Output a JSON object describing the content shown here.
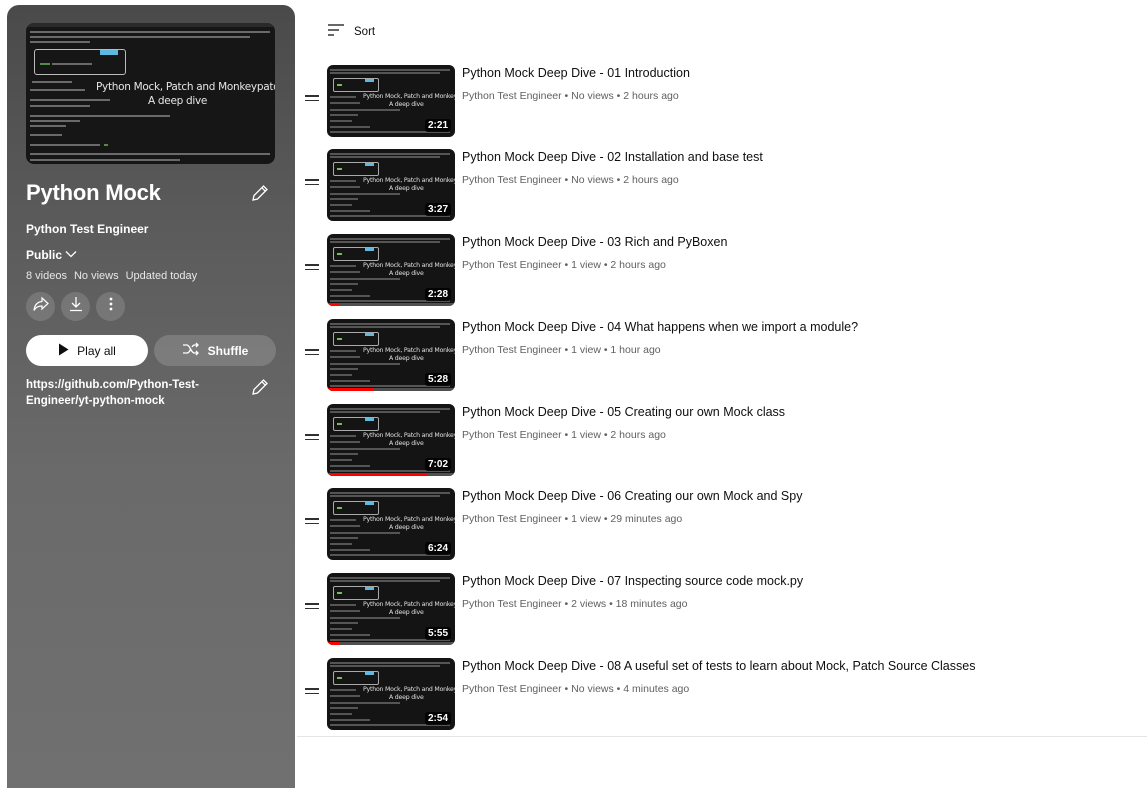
{
  "playlist": {
    "title": "Python Mock",
    "channel": "Python Test Engineer",
    "privacy": "Public",
    "video_count": "8 videos",
    "views": "No views",
    "updated": "Updated today",
    "play_all_label": "Play all",
    "shuffle_label": "Shuffle",
    "description": "https://github.com/Python-Test-Engineer/yt-python-mock",
    "hero_text_1": "Python Mock, Patch and Monkeypatch",
    "hero_text_2": "A deep dive"
  },
  "sort_label": "Sort",
  "thumb_text_1": "Python Mock, Patch and Monkeypatch",
  "thumb_text_2": "A deep dive",
  "videos": [
    {
      "title": "Python Mock Deep Dive - 01 Introduction",
      "channel": "Python Test Engineer",
      "views": "No views",
      "age": "2 hours ago",
      "duration": "2:21",
      "watched": 0
    },
    {
      "title": "Python Mock Deep Dive - 02 Installation and base test",
      "channel": "Python Test Engineer",
      "views": "No views",
      "age": "2 hours ago",
      "duration": "3:27",
      "watched": 0
    },
    {
      "title": "Python Mock Deep Dive - 03 Rich and PyBoxen",
      "channel": "Python Test Engineer",
      "views": "1 view",
      "age": "2 hours ago",
      "duration": "2:28",
      "watched": 0.1
    },
    {
      "title": "Python Mock Deep Dive - 04 What happens when we import a module?",
      "channel": "Python Test Engineer",
      "views": "1 view",
      "age": "1 hour ago",
      "duration": "5:28",
      "watched": 0.37
    },
    {
      "title": "Python Mock Deep Dive - 05 Creating our own Mock class",
      "channel": "Python Test Engineer",
      "views": "1 view",
      "age": "2 hours ago",
      "duration": "7:02",
      "watched": 0.78
    },
    {
      "title": "Python Mock Deep Dive - 06 Creating our own Mock and Spy",
      "channel": "Python Test Engineer",
      "views": "1 view",
      "age": "29 minutes ago",
      "duration": "6:24",
      "watched": 0
    },
    {
      "title": "Python Mock Deep Dive - 07 Inspecting source code mock.py",
      "channel": "Python Test Engineer",
      "views": "2 views",
      "age": "18 minutes ago",
      "duration": "5:55",
      "watched": 0.1
    },
    {
      "title": "Python Mock Deep Dive - 08 A useful set of tests to learn about Mock, Patch Source Classes",
      "channel": "Python Test Engineer",
      "views": "No views",
      "age": "4 minutes ago",
      "duration": "2:54",
      "watched": 0
    }
  ]
}
